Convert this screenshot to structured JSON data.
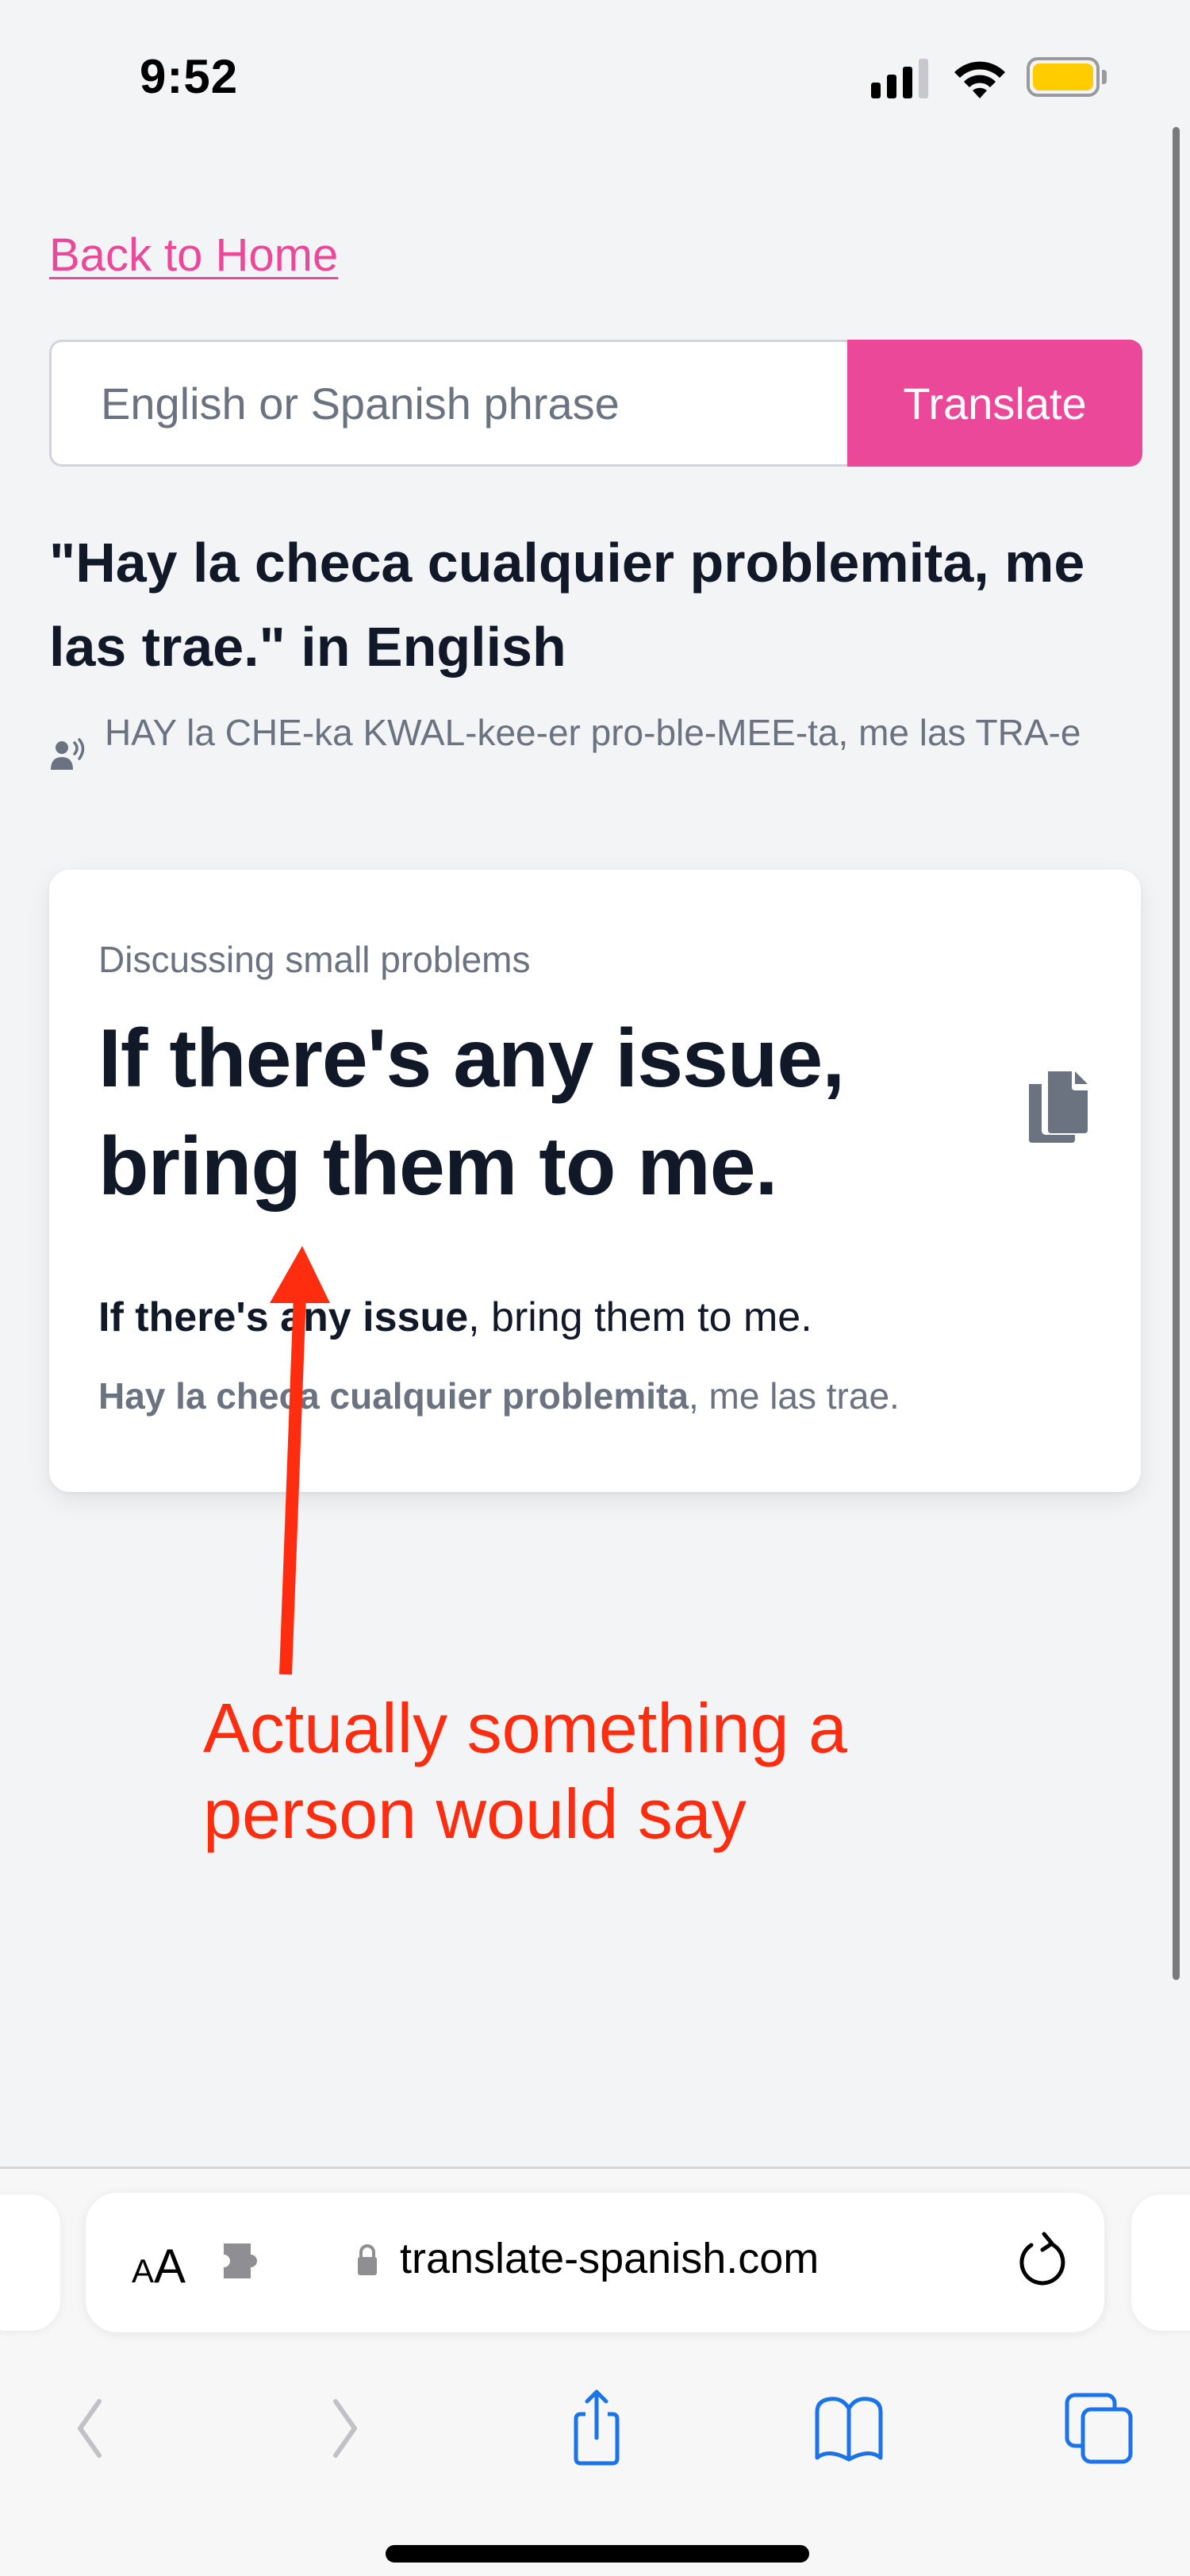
{
  "status_bar": {
    "time": "9:52",
    "signal_bars_active": 3,
    "signal_bars_total": 4,
    "battery_color": "#ffcc00"
  },
  "page": {
    "back_link": "Back to Home",
    "search": {
      "placeholder": "English or Spanish phrase",
      "value": "",
      "button_label": "Translate"
    },
    "heading": {
      "quoted_phrase": "\"Hay la checa cualquier problemita, me las trae.\"",
      "suffix": " in English"
    },
    "pronunciation": {
      "icon": "speaking-person-icon",
      "text": "HAY la CHE-ka KWAL-kee-er pro-ble-MEE-ta, me las TRA-e"
    },
    "result_card": {
      "context": "Discussing small problems",
      "translation": "If there's any issue, bring them to me.",
      "copy_icon": "copy-icon",
      "english_bold": "If there's any issue",
      "english_rest": ", bring them to me.",
      "spanish_bold": "Hay la checa cualquier problemita",
      "spanish_rest": ", me las trae."
    }
  },
  "annotation": {
    "text_line1": "Actually something a",
    "text_line2": "person would say",
    "color": "#ff2d0f"
  },
  "browser": {
    "text_size_label_small": "A",
    "text_size_label_large": "A",
    "extension_icon": "puzzle-piece-icon",
    "lock_icon": "lock-icon",
    "url": "translate-spanish.com",
    "reload_icon": "reload-icon",
    "toolbar": [
      {
        "name": "back",
        "icon": "chevron-left-icon",
        "enabled": false
      },
      {
        "name": "forward",
        "icon": "chevron-right-icon",
        "enabled": false
      },
      {
        "name": "share",
        "icon": "share-icon",
        "enabled": true
      },
      {
        "name": "bookmarks",
        "icon": "book-icon",
        "enabled": true
      },
      {
        "name": "tabs",
        "icon": "tabs-icon",
        "enabled": true
      }
    ]
  },
  "colors": {
    "accent": "#ec4899",
    "background": "#f3f4f6",
    "text_primary": "#111827",
    "text_secondary": "#6b7280",
    "safari_blue": "#1a73e8"
  }
}
